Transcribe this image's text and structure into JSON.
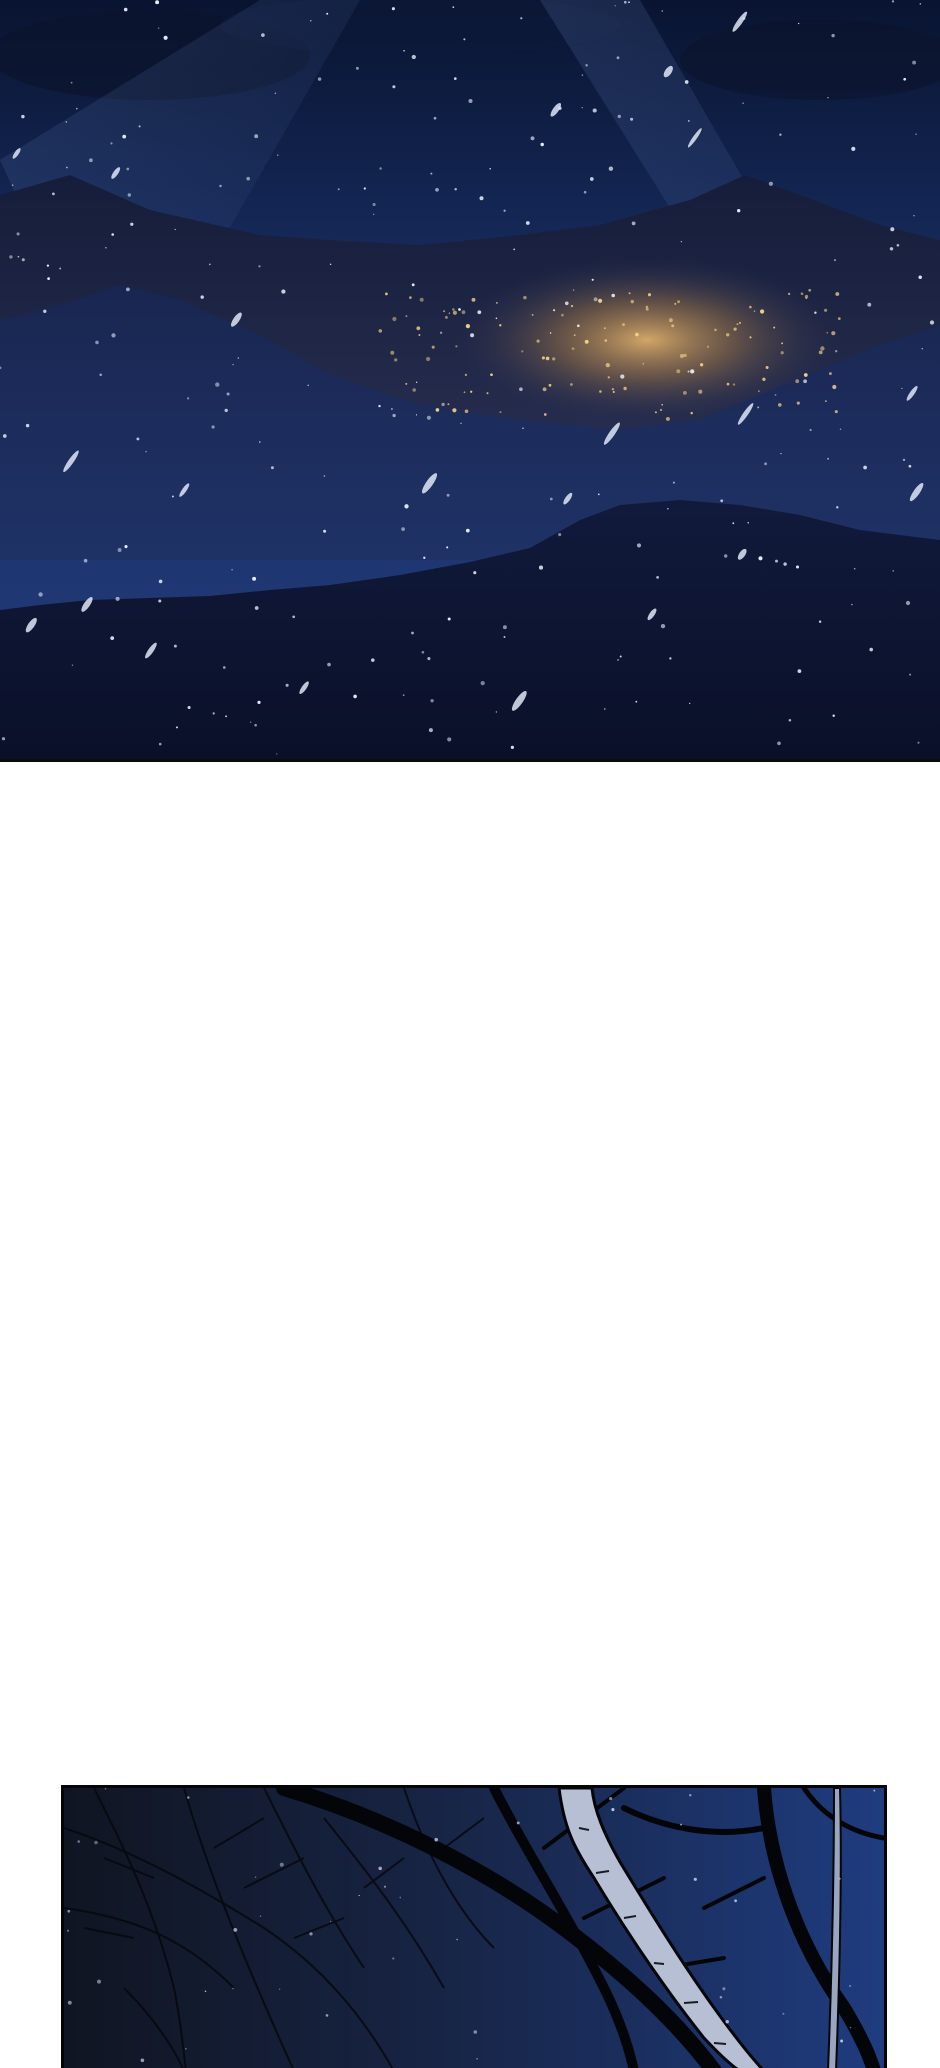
{
  "page": {
    "background": "#ffffff"
  },
  "panels": [
    {
      "id": "panel-1",
      "scene": "night-mountains-snowfall",
      "palette": {
        "sky_top": "#0a1636",
        "sky_mid": "#1d3470",
        "glow": "#c99a55",
        "ridge": "#1a2546",
        "forest": "#0c1230"
      }
    },
    {
      "id": "panel-2",
      "scene": "bare-trees-night-sky",
      "palette": {
        "sky": "#1d3a78",
        "branches": "#06070c",
        "birch": "#b9c2d6"
      }
    }
  ]
}
